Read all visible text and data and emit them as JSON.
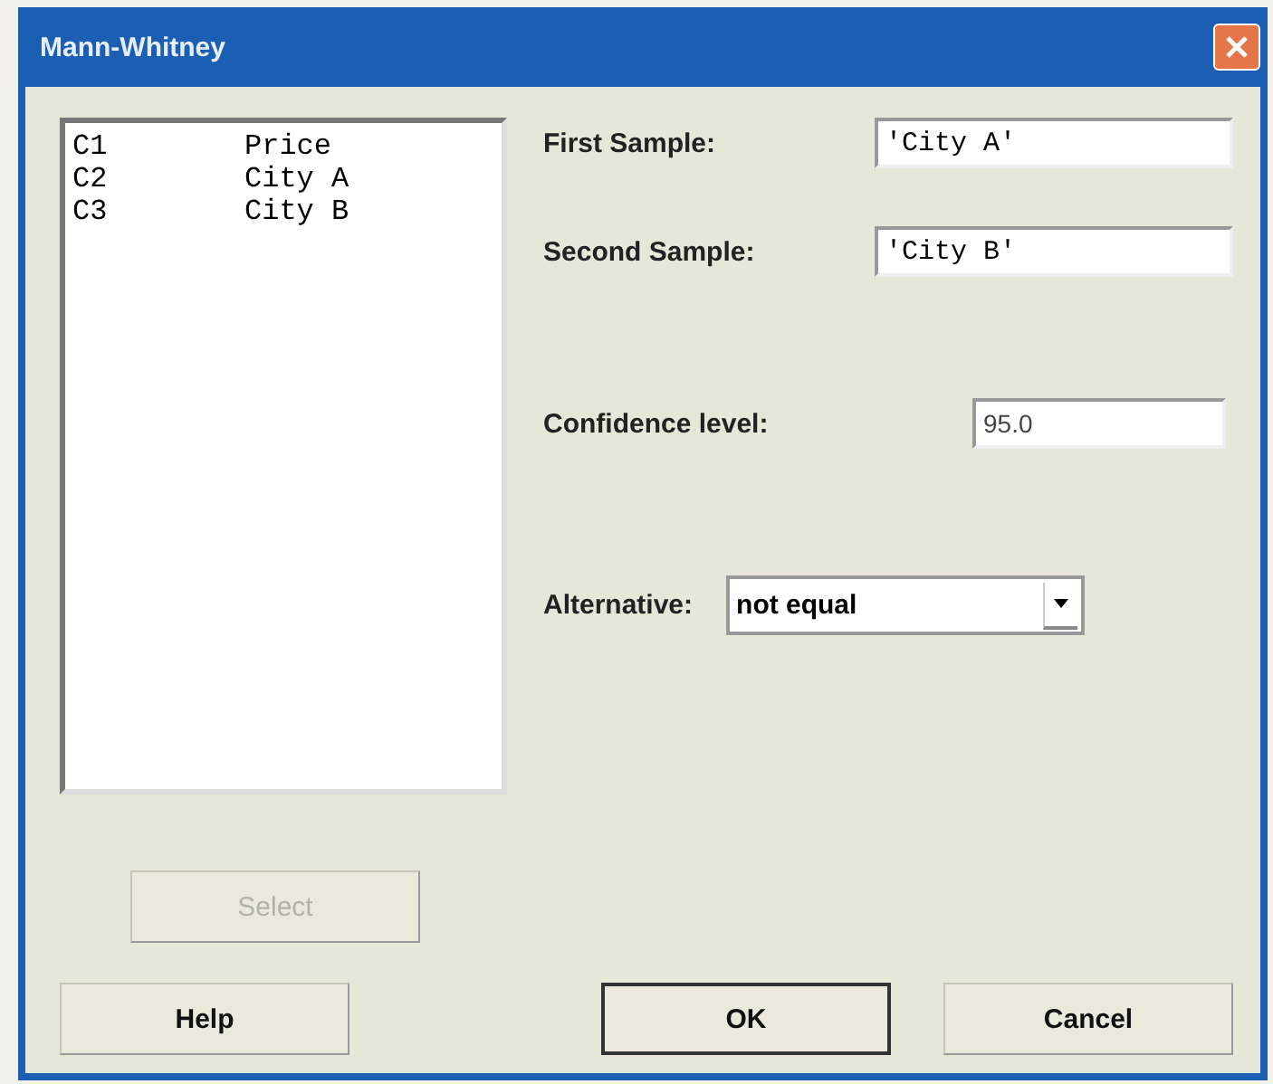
{
  "window": {
    "title": "Mann-Whitney"
  },
  "variables": [
    {
      "column": "C1",
      "name": "Price"
    },
    {
      "column": "C2",
      "name": "City A"
    },
    {
      "column": "C3",
      "name": "City B"
    }
  ],
  "fields": [
    {
      "kind": "text",
      "label": "First Sample:",
      "value": "'City A'"
    },
    {
      "kind": "text",
      "label": "Second Sample:",
      "value": "'City B'"
    },
    {
      "kind": "number",
      "label": "Confidence level:",
      "value": "95.0"
    },
    {
      "kind": "dropdown",
      "label": "Alternative:",
      "value": "not equal"
    }
  ],
  "select_button": {
    "label": "Select",
    "disabled": true
  },
  "buttons": [
    {
      "label": "Help",
      "default": false
    },
    {
      "label": "OK",
      "default": true
    },
    {
      "label": "Cancel",
      "default": false
    }
  ]
}
